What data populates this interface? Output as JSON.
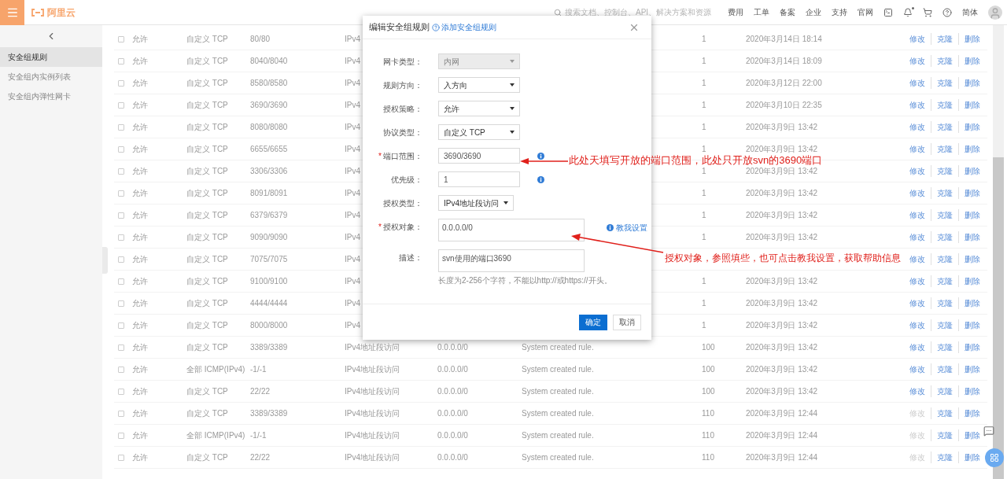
{
  "topbar": {
    "logo": "阿里云",
    "search": {
      "placeholder": "搜索文档、控制台、API、解决方案和资源"
    },
    "nav": [
      "费用",
      "工单",
      "备案",
      "企业",
      "支持",
      "官网"
    ],
    "bell_unread": true,
    "language": "简体"
  },
  "sidebar": {
    "items": [
      {
        "label": "安全组规则",
        "selected": true
      },
      {
        "label": "安全组内实例列表",
        "selected": false
      },
      {
        "label": "安全组内弹性网卡",
        "selected": false
      }
    ]
  },
  "table": {
    "rows": [
      {
        "checked": false,
        "policy": "允许",
        "protocol": "自定义 TCP",
        "port": "80/80",
        "auth_type": "IPv4",
        "priority": "1",
        "time": "2020年3月14日 18:14",
        "actions": [
          {
            "label": "修改",
            "disabled": false
          },
          {
            "label": "克隆",
            "disabled": false
          },
          {
            "label": "删除",
            "disabled": false
          }
        ]
      },
      {
        "checked": false,
        "policy": "允许",
        "protocol": "自定义 TCP",
        "port": "8040/8040",
        "auth_type": "IPv4",
        "priority": "1",
        "time": "2020年3月14日 18:09",
        "actions": [
          {
            "label": "修改",
            "disabled": false
          },
          {
            "label": "克隆",
            "disabled": false
          },
          {
            "label": "删除",
            "disabled": false
          }
        ]
      },
      {
        "checked": false,
        "policy": "允许",
        "protocol": "自定义 TCP",
        "port": "8580/8580",
        "auth_type": "IPv4",
        "priority": "1",
        "time": "2020年3月12日 22:00",
        "actions": [
          {
            "label": "修改",
            "disabled": false
          },
          {
            "label": "克隆",
            "disabled": false
          },
          {
            "label": "删除",
            "disabled": false
          }
        ]
      },
      {
        "checked": false,
        "policy": "允许",
        "protocol": "自定义 TCP",
        "port": "3690/3690",
        "auth_type": "IPv4",
        "priority": "1",
        "time": "2020年3月10日 22:35",
        "actions": [
          {
            "label": "修改",
            "disabled": false
          },
          {
            "label": "克隆",
            "disabled": false
          },
          {
            "label": "删除",
            "disabled": false
          }
        ]
      },
      {
        "checked": false,
        "policy": "允许",
        "protocol": "自定义 TCP",
        "port": "8080/8080",
        "auth_type": "IPv4",
        "priority": "1",
        "time": "2020年3月9日 13:42",
        "actions": [
          {
            "label": "修改",
            "disabled": false
          },
          {
            "label": "克隆",
            "disabled": false
          },
          {
            "label": "删除",
            "disabled": false
          }
        ]
      },
      {
        "checked": false,
        "policy": "允许",
        "protocol": "自定义 TCP",
        "port": "6655/6655",
        "auth_type": "IPv4",
        "priority": "1",
        "time": "2020年3月9日 13:42",
        "actions": [
          {
            "label": "修改",
            "disabled": false
          },
          {
            "label": "克隆",
            "disabled": false
          },
          {
            "label": "删除",
            "disabled": false
          }
        ]
      },
      {
        "checked": false,
        "policy": "允许",
        "protocol": "自定义 TCP",
        "port": "3306/3306",
        "auth_type": "IPv4",
        "priority": "1",
        "time": "2020年3月9日 13:42",
        "actions": [
          {
            "label": "修改",
            "disabled": false
          },
          {
            "label": "克隆",
            "disabled": false
          },
          {
            "label": "删除",
            "disabled": false
          }
        ]
      },
      {
        "checked": false,
        "policy": "允许",
        "protocol": "自定义 TCP",
        "port": "8091/8091",
        "auth_type": "IPv4",
        "priority": "1",
        "time": "2020年3月9日 13:42",
        "actions": [
          {
            "label": "修改",
            "disabled": false
          },
          {
            "label": "克隆",
            "disabled": false
          },
          {
            "label": "删除",
            "disabled": false
          }
        ]
      },
      {
        "checked": false,
        "policy": "允许",
        "protocol": "自定义 TCP",
        "port": "6379/6379",
        "auth_type": "IPv4",
        "priority": "1",
        "time": "2020年3月9日 13:42",
        "actions": [
          {
            "label": "修改",
            "disabled": false
          },
          {
            "label": "克隆",
            "disabled": false
          },
          {
            "label": "删除",
            "disabled": false
          }
        ]
      },
      {
        "checked": false,
        "policy": "允许",
        "protocol": "自定义 TCP",
        "port": "9090/9090",
        "auth_type": "IPv4",
        "priority": "1",
        "time": "2020年3月9日 13:42",
        "actions": [
          {
            "label": "修改",
            "disabled": false
          },
          {
            "label": "克隆",
            "disabled": false
          },
          {
            "label": "删除",
            "disabled": false
          }
        ]
      },
      {
        "checked": false,
        "policy": "允许",
        "protocol": "自定义 TCP",
        "port": "7075/7075",
        "auth_type": "IPv4",
        "actions": [
          {
            "label": "修改",
            "disabled": false
          },
          {
            "label": "克隆",
            "disabled": false
          },
          {
            "label": "删除",
            "disabled": false
          }
        ]
      },
      {
        "checked": false,
        "policy": "允许",
        "protocol": "自定义 TCP",
        "port": "9100/9100",
        "auth_type": "IPv4",
        "priority": "1",
        "time": "2020年3月9日 13:42",
        "actions": [
          {
            "label": "修改",
            "disabled": false
          },
          {
            "label": "克隆",
            "disabled": false
          },
          {
            "label": "删除",
            "disabled": false
          }
        ]
      },
      {
        "checked": false,
        "policy": "允许",
        "protocol": "自定义 TCP",
        "port": "4444/4444",
        "auth_type": "IPv4",
        "priority": "1",
        "time": "2020年3月9日 13:42",
        "actions": [
          {
            "label": "修改",
            "disabled": false
          },
          {
            "label": "克隆",
            "disabled": false
          },
          {
            "label": "删除",
            "disabled": false
          }
        ]
      },
      {
        "checked": false,
        "policy": "允许",
        "protocol": "自定义 TCP",
        "port": "8000/8000",
        "auth_type": "IPv4",
        "priority": "1",
        "time": "2020年3月9日 13:42",
        "actions": [
          {
            "label": "修改",
            "disabled": false
          },
          {
            "label": "克隆",
            "disabled": false
          },
          {
            "label": "删除",
            "disabled": false
          }
        ]
      },
      {
        "checked": false,
        "policy": "允许",
        "protocol": "自定义 TCP",
        "port": "3389/3389",
        "auth_type": "IPv4地址段访问",
        "auth_object": "0.0.0.0/0",
        "description": "System created rule.",
        "priority": "100",
        "time": "2020年3月9日 13:42",
        "actions": [
          {
            "label": "修改",
            "disabled": false
          },
          {
            "label": "克隆",
            "disabled": false
          },
          {
            "label": "删除",
            "disabled": false
          }
        ]
      },
      {
        "checked": false,
        "policy": "允许",
        "protocol": "全部 ICMP(IPv4)",
        "port": "-1/-1",
        "auth_type": "IPv4地址段访问",
        "auth_object": "0.0.0.0/0",
        "description": "System created rule.",
        "priority": "100",
        "time": "2020年3月9日 13:42",
        "actions": [
          {
            "label": "修改",
            "disabled": false
          },
          {
            "label": "克隆",
            "disabled": false
          },
          {
            "label": "删除",
            "disabled": false
          }
        ]
      },
      {
        "checked": false,
        "policy": "允许",
        "protocol": "自定义 TCP",
        "port": "22/22",
        "auth_type": "IPv4地址段访问",
        "auth_object": "0.0.0.0/0",
        "description": "System created rule.",
        "priority": "100",
        "time": "2020年3月9日 13:42",
        "actions": [
          {
            "label": "修改",
            "disabled": false
          },
          {
            "label": "克隆",
            "disabled": false
          },
          {
            "label": "删除",
            "disabled": false
          }
        ]
      },
      {
        "checked": false,
        "policy": "允许",
        "protocol": "自定义 TCP",
        "port": "3389/3389",
        "auth_type": "IPv4地址段访问",
        "auth_object": "0.0.0.0/0",
        "description": "System created rule.",
        "priority": "110",
        "time": "2020年3月9日 12:44",
        "actions": [
          {
            "label": "修改",
            "disabled": true
          },
          {
            "label": "克隆",
            "disabled": false
          },
          {
            "label": "删除",
            "disabled": false
          }
        ]
      },
      {
        "checked": false,
        "policy": "允许",
        "protocol": "全部 ICMP(IPv4)",
        "port": "-1/-1",
        "auth_type": "IPv4地址段访问",
        "auth_object": "0.0.0.0/0",
        "description": "System created rule.",
        "priority": "110",
        "time": "2020年3月9日 12:44",
        "actions": [
          {
            "label": "修改",
            "disabled": true
          },
          {
            "label": "克隆",
            "disabled": false
          },
          {
            "label": "删除",
            "disabled": false
          }
        ]
      },
      {
        "checked": false,
        "policy": "允许",
        "protocol": "自定义 TCP",
        "port": "22/22",
        "auth_type": "IPv4地址段访问",
        "auth_object": "0.0.0.0/0",
        "description": "System created rule.",
        "priority": "110",
        "time": "2020年3月9日 12:44",
        "actions": [
          {
            "label": "修改",
            "disabled": true
          },
          {
            "label": "克隆",
            "disabled": false
          },
          {
            "label": "删除",
            "disabled": false
          }
        ]
      }
    ]
  },
  "dialog": {
    "title": "编辑安全组规则",
    "help_link": "添加安全组规则",
    "fields": [
      {
        "kind": "select",
        "label": "网卡类型：",
        "value": "内网",
        "disabled": true
      },
      {
        "kind": "select",
        "label": "规则方向：",
        "value": "入方向",
        "disabled": false
      },
      {
        "kind": "select",
        "label": "授权策略：",
        "value": "允许",
        "disabled": false
      },
      {
        "kind": "select",
        "label": "协议类型：",
        "value": "自定义 TCP",
        "disabled": false
      },
      {
        "kind": "input",
        "label": "端口范围：",
        "required_mark": "*",
        "value": "3690/3690",
        "info": true
      },
      {
        "kind": "input",
        "label": "优先级：",
        "value": "1",
        "info": true
      },
      {
        "kind": "short_select",
        "label": "授权类型：",
        "value": "IPv4地址段访问",
        "disabled": false
      },
      {
        "kind": "textarea",
        "label": "授权对象：",
        "required_mark": "*",
        "value": "0.0.0.0/0",
        "link": "教我设置"
      },
      {
        "kind": "textarea",
        "label": "描述：",
        "value": "svn使用的端口3690",
        "hint": "长度为2-256个字符，不能以http://或https://开头。"
      }
    ],
    "buttons": [
      {
        "label": "确定",
        "primary": true
      },
      {
        "label": "取消",
        "primary": false
      }
    ]
  },
  "annotations": [
    "此处天填写开放的端口范围，此处只开放svn的3690端口",
    "授权对象，参照填些，也可点击教我设置，获取帮助信息"
  ]
}
